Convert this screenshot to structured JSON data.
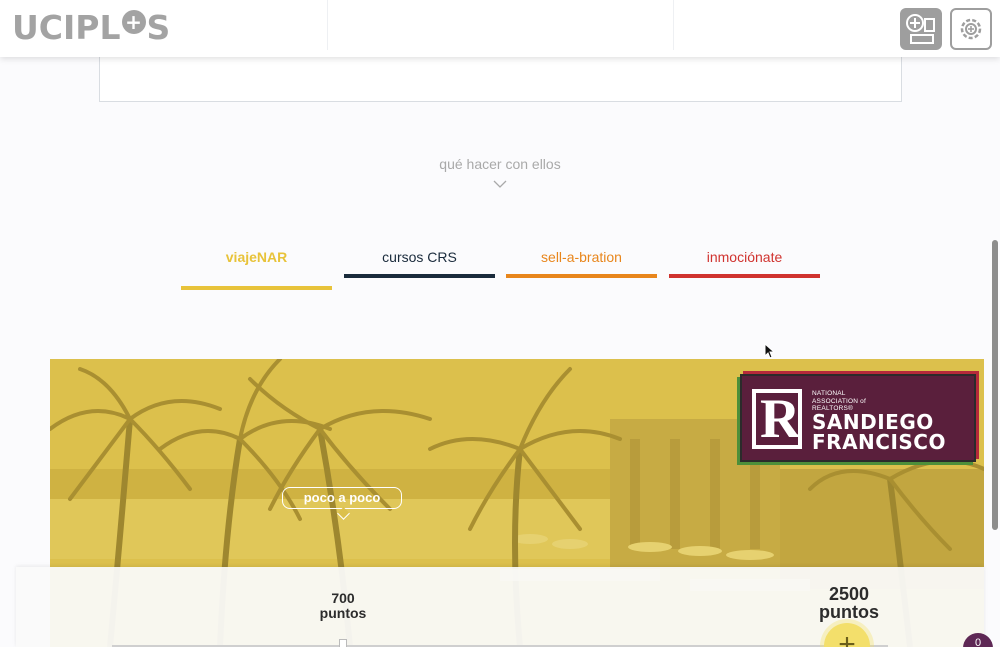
{
  "header": {
    "logo_left": "UCIPL",
    "logo_right": "S",
    "logo_plus": "+",
    "buttons": [
      "add-card-icon",
      "settings-gear-icon"
    ]
  },
  "section": {
    "what_to_do": "qué hacer con ellos"
  },
  "tabs": [
    {
      "label": "viajeNAR",
      "color": "#e8c33a",
      "active": true
    },
    {
      "label": "cursos CRS",
      "color": "#1a2b3c",
      "active": false
    },
    {
      "label": "sell-a-bration",
      "color": "#e8861c",
      "active": false
    },
    {
      "label": "inmociónate",
      "color": "#d0332f",
      "active": false
    }
  ],
  "hero": {
    "bubble": "poco a poco",
    "nar_logo": {
      "letter": "R",
      "org_line1": "NATIONAL",
      "org_line2": "ASSOCIATION of",
      "org_line3": "REALTORS®",
      "city1": "SANDIEGO",
      "city2": "FRANCISCO"
    }
  },
  "points": {
    "min_value": "700",
    "min_unit": "puntos",
    "max_value": "2500",
    "max_unit": "puntos",
    "knob_symbol": "+"
  },
  "chat_badge": "0",
  "colors": {
    "accent_yellow": "#e8c33a",
    "navy": "#1a2b3c",
    "orange": "#e8861c",
    "red": "#d0332f",
    "hero_overlay": "#dcc04c",
    "nar_maroon": "#5a1f3c"
  }
}
